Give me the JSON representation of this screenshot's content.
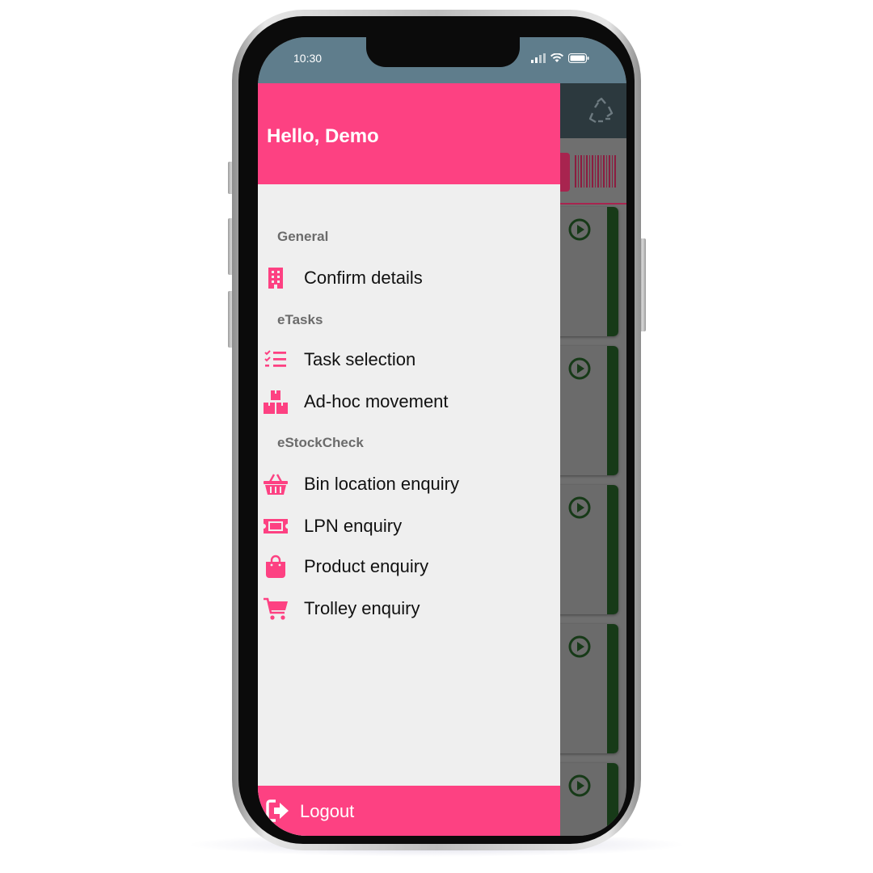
{
  "status_bar": {
    "time": "10:30"
  },
  "drawer": {
    "greeting": "Hello, Demo",
    "sections": [
      {
        "title": "General",
        "items": [
          {
            "label": "Confirm details",
            "icon": "building-icon"
          }
        ]
      },
      {
        "title": "eTasks",
        "items": [
          {
            "label": "Task selection",
            "icon": "checklist-icon"
          },
          {
            "label": "Ad-hoc movement",
            "icon": "boxes-icon"
          }
        ]
      },
      {
        "title": "eStockCheck",
        "items": [
          {
            "label": "Bin location enquiry",
            "icon": "basket-icon"
          },
          {
            "label": "LPN enquiry",
            "icon": "ticket-icon"
          },
          {
            "label": "Product enquiry",
            "icon": "shopping-bag-icon"
          },
          {
            "label": "Trolley enquiry",
            "icon": "cart-icon"
          }
        ]
      }
    ],
    "logout_label": "Logout"
  },
  "colors": {
    "accent": "#fd4182",
    "drawer_bg": "#efefef",
    "appbar": "#2c393e",
    "status_bar": "#5f7d8c",
    "card_stripe": "#173a18"
  }
}
